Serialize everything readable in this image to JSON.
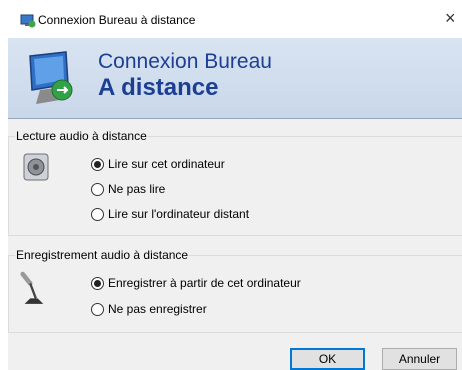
{
  "window": {
    "title": "Connexion Bureau à distance",
    "close_glyph": "×"
  },
  "banner": {
    "line1": "Connexion Bureau",
    "line2": "A distance"
  },
  "playback": {
    "legend": "Lecture audio à distance",
    "options": [
      {
        "label": "Lire sur cet ordinateur",
        "checked": true
      },
      {
        "label": "Ne pas lire",
        "checked": false
      },
      {
        "label": "Lire sur l'ordinateur distant",
        "checked": false
      }
    ]
  },
  "recording": {
    "legend": "Enregistrement audio à distance",
    "options": [
      {
        "label": "Enregistrer à partir de cet ordinateur",
        "checked": true
      },
      {
        "label": "Ne pas enregistrer",
        "checked": false
      }
    ]
  },
  "buttons": {
    "ok": "OK",
    "cancel": "Annuler"
  },
  "icons": {
    "app": "remote-desktop-icon",
    "banner": "remote-desktop-monitor-icon",
    "speaker": "speaker-icon",
    "microphone": "microphone-icon"
  },
  "colors": {
    "banner_text": "#1c3f94",
    "accent": "#0078d7"
  }
}
